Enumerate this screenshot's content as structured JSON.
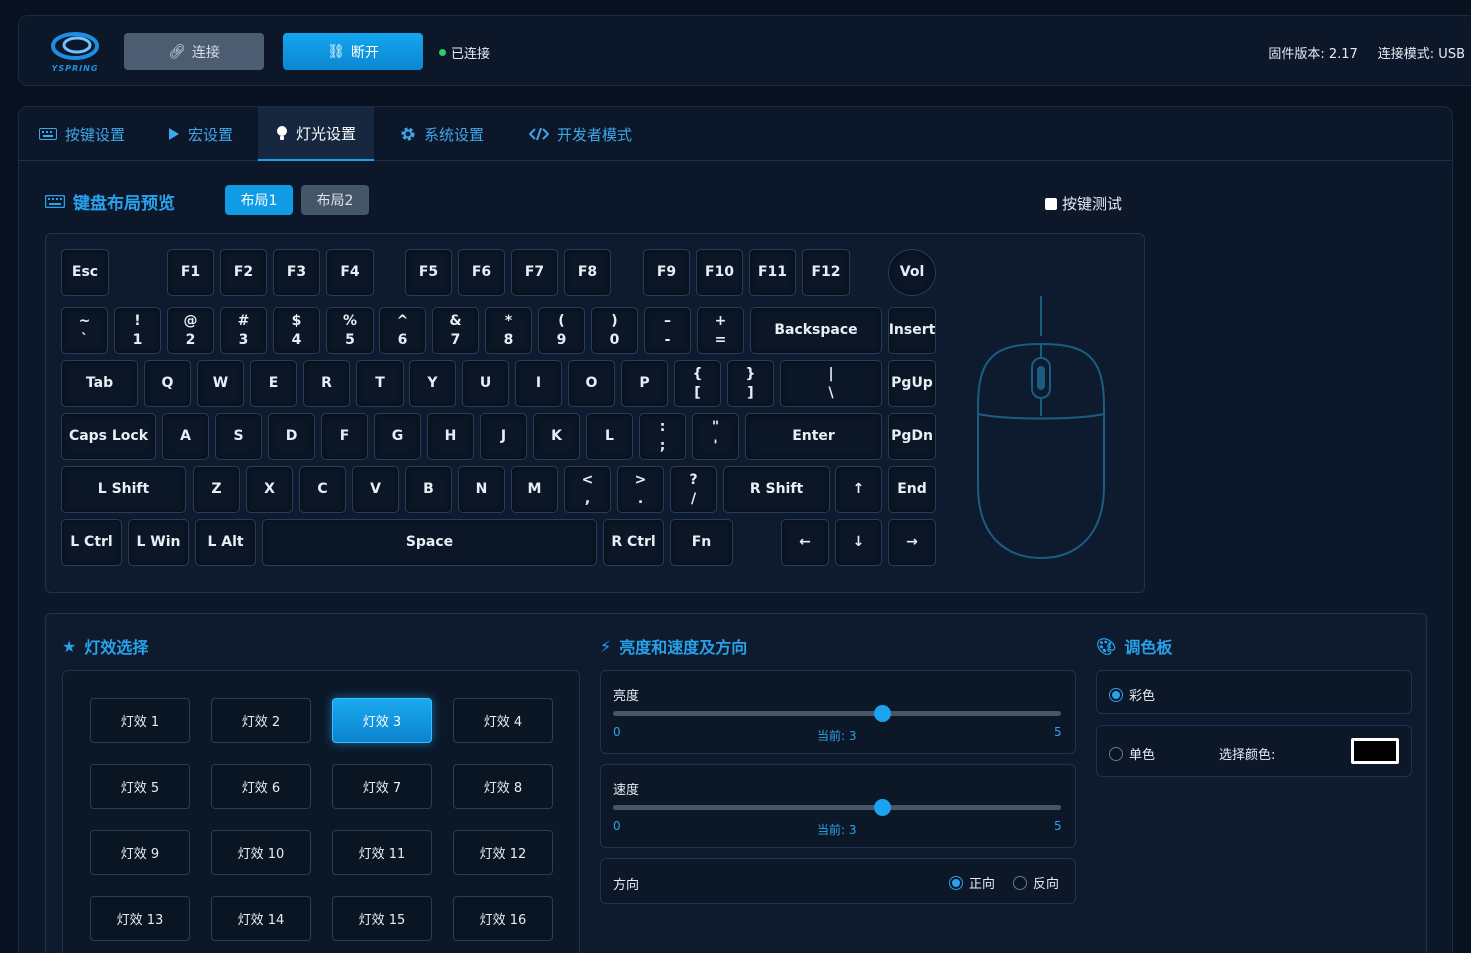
{
  "app": {
    "logo_text": "YSPRING"
  },
  "topbar": {
    "connect_label": "连接",
    "disconnect_label": "断开",
    "status_label": "已连接",
    "firmware_label": "固件版本: 2.17",
    "mode_label": "连接模式: USB"
  },
  "tabs": [
    {
      "label": "按键设置",
      "icon": "keyboard-icon"
    },
    {
      "label": "宏设置",
      "icon": "play-icon"
    },
    {
      "label": "灯光设置",
      "icon": "lightbulb-icon"
    },
    {
      "label": "系统设置",
      "icon": "gear-icon"
    },
    {
      "label": "开发者模式",
      "icon": "code-icon"
    }
  ],
  "active_tab": "灯光设置",
  "keyboard_section": {
    "title": "键盘布局预览",
    "layout1": "布局1",
    "layout2": "布局2",
    "active_layout": "布局1",
    "key_test_label": "按键测试",
    "key_test_checked": false
  },
  "keys": {
    "row0": [
      "Esc",
      "F1",
      "F2",
      "F3",
      "F4",
      "F5",
      "F6",
      "F7",
      "F8",
      "F9",
      "F10",
      "F11",
      "F12",
      "Vol"
    ],
    "row1": [
      "~\n`",
      "!\n1",
      "@\n2",
      "#\n3",
      "$\n4",
      "%\n5",
      "^\n6",
      "&\n7",
      "*\n8",
      "(\n9",
      ")\n0",
      "–\n-",
      "+\n=",
      "Backspace",
      "Insert"
    ],
    "row2": [
      "Tab",
      "Q",
      "W",
      "E",
      "R",
      "T",
      "Y",
      "U",
      "I",
      "O",
      "P",
      "{\n[",
      "}\n]",
      "|\n\\",
      "PgUp"
    ],
    "row3": [
      "Caps Lock",
      "A",
      "S",
      "D",
      "F",
      "G",
      "H",
      "J",
      "K",
      "L",
      ":\n;",
      "\"\n'",
      "Enter",
      "PgDn"
    ],
    "row4": [
      "L Shift",
      "Z",
      "X",
      "C",
      "V",
      "B",
      "N",
      "M",
      "<\n,",
      ">\n.",
      "?\n/",
      "R Shift",
      "↑",
      "End"
    ],
    "row5": [
      "L Ctrl",
      "L Win",
      "L Alt",
      "Space",
      "R Ctrl",
      "Fn",
      "←",
      "↓",
      "→"
    ]
  },
  "effects_section": {
    "title": "灯效选择",
    "effects": [
      "灯效 1",
      "灯效 2",
      "灯效 3",
      "灯效 4",
      "灯效 5",
      "灯效 6",
      "灯效 7",
      "灯效 8",
      "灯效 9",
      "灯效 10",
      "灯效 11",
      "灯效 12",
      "灯效 13",
      "灯效 14",
      "灯效 15",
      "灯效 16"
    ],
    "selected": "灯效 3"
  },
  "brightness_section": {
    "title": "亮度和速度及方向",
    "brightness": {
      "label": "亮度",
      "min": "0",
      "max": "5",
      "value": 3,
      "current_label": "当前: 3"
    },
    "speed": {
      "label": "速度",
      "min": "0",
      "max": "5",
      "value": 3,
      "current_label": "当前: 3"
    },
    "direction": {
      "label": "方向",
      "forward": "正向",
      "reverse": "反向",
      "selected": "正向"
    }
  },
  "palette_section": {
    "title": "调色板",
    "rainbow_label": "彩色",
    "single_label": "单色",
    "pick_color_label": "选择颜色:",
    "selected_mode": "彩色",
    "color": "#000000"
  },
  "colors": {
    "accent": "#13a4ee",
    "background": "#081120",
    "status_ok": "#2ecc71"
  }
}
